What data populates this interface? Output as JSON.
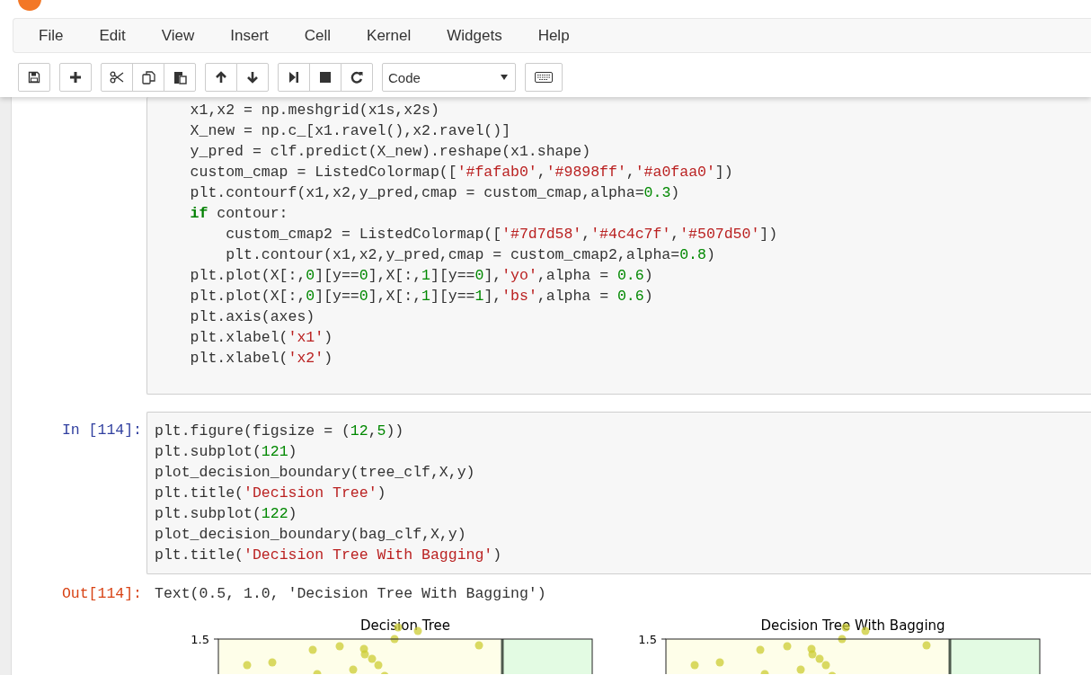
{
  "menu": [
    {
      "label": "File"
    },
    {
      "label": "Edit"
    },
    {
      "label": "View"
    },
    {
      "label": "Insert"
    },
    {
      "label": "Cell"
    },
    {
      "label": "Kernel"
    },
    {
      "label": "Widgets"
    },
    {
      "label": "Help"
    }
  ],
  "toolbar": {
    "groups": [
      [
        {
          "kind": "save"
        }
      ],
      [
        {
          "kind": "add"
        }
      ],
      [
        {
          "kind": "cut"
        },
        {
          "kind": "copy"
        },
        {
          "kind": "paste"
        }
      ],
      [
        {
          "kind": "up"
        },
        {
          "kind": "down"
        }
      ],
      [
        {
          "kind": "run"
        },
        {
          "kind": "stop"
        },
        {
          "kind": "restart"
        }
      ]
    ],
    "cell_type": "Code"
  },
  "cells": [
    {
      "lines": [
        {
          "tokens": [
            {
              "kind": "plain",
              "text": "x1,x2 = np.meshgrid(x1s,x2s)"
            }
          ]
        },
        {
          "tokens": [
            {
              "kind": "plain",
              "text": "X_new = np.c_[x1.ravel(),x2.ravel()]"
            }
          ]
        },
        {
          "tokens": [
            {
              "kind": "plain",
              "text": "y_pred = clf.predict(X_new).reshape(x1.shape)"
            }
          ]
        },
        {
          "tokens": [
            {
              "kind": "plain",
              "text": "custom_cmap = ListedColormap(["
            },
            {
              "kind": "str",
              "text": "'#fafab0'"
            },
            {
              "kind": "plain",
              "text": ","
            },
            {
              "kind": "str",
              "text": "'#9898ff'"
            },
            {
              "kind": "plain",
              "text": ","
            },
            {
              "kind": "str",
              "text": "'#a0faa0'"
            },
            {
              "kind": "plain",
              "text": "])"
            }
          ]
        },
        {
          "tokens": [
            {
              "kind": "plain",
              "text": "plt.contourf(x1,x2,y_pred,cmap = custom_cmap,alpha="
            },
            {
              "kind": "num",
              "text": "0.3"
            },
            {
              "kind": "plain",
              "text": ")"
            }
          ]
        },
        {
          "tokens": [
            {
              "kind": "kw",
              "text": "if"
            },
            {
              "kind": "plain",
              "text": " contour:"
            }
          ],
          "children": [
            {
              "tokens": [
                {
                  "kind": "plain",
                  "text": "custom_cmap2 = ListedColormap(["
                },
                {
                  "kind": "str",
                  "text": "'#7d7d58'"
                },
                {
                  "kind": "plain",
                  "text": ","
                },
                {
                  "kind": "str",
                  "text": "'#4c4c7f'"
                },
                {
                  "kind": "plain",
                  "text": ","
                },
                {
                  "kind": "str",
                  "text": "'#507d50'"
                },
                {
                  "kind": "plain",
                  "text": "])"
                }
              ]
            },
            {
              "tokens": [
                {
                  "kind": "plain",
                  "text": "plt.contour(x1,x2,y_pred,cmap = custom_cmap2,alpha="
                },
                {
                  "kind": "num",
                  "text": "0.8"
                },
                {
                  "kind": "plain",
                  "text": ")"
                }
              ]
            }
          ]
        },
        {
          "tokens": [
            {
              "kind": "plain",
              "text": "plt.plot(X[:,"
            },
            {
              "kind": "num",
              "text": "0"
            },
            {
              "kind": "plain",
              "text": "][y=="
            },
            {
              "kind": "num",
              "text": "0"
            },
            {
              "kind": "plain",
              "text": "],X[:,"
            },
            {
              "kind": "num",
              "text": "1"
            },
            {
              "kind": "plain",
              "text": "][y=="
            },
            {
              "kind": "num",
              "text": "0"
            },
            {
              "kind": "plain",
              "text": "],"
            },
            {
              "kind": "str",
              "text": "'yo'"
            },
            {
              "kind": "plain",
              "text": ",alpha = "
            },
            {
              "kind": "num",
              "text": "0.6"
            },
            {
              "kind": "plain",
              "text": ")"
            }
          ]
        },
        {
          "tokens": [
            {
              "kind": "plain",
              "text": "plt.plot(X[:,"
            },
            {
              "kind": "num",
              "text": "0"
            },
            {
              "kind": "plain",
              "text": "][y=="
            },
            {
              "kind": "num",
              "text": "0"
            },
            {
              "kind": "plain",
              "text": "],X[:,"
            },
            {
              "kind": "num",
              "text": "1"
            },
            {
              "kind": "plain",
              "text": "][y=="
            },
            {
              "kind": "num",
              "text": "1"
            },
            {
              "kind": "plain",
              "text": "],"
            },
            {
              "kind": "str",
              "text": "'bs'"
            },
            {
              "kind": "plain",
              "text": ",alpha = "
            },
            {
              "kind": "num",
              "text": "0.6"
            },
            {
              "kind": "plain",
              "text": ")"
            }
          ]
        },
        {
          "tokens": [
            {
              "kind": "plain",
              "text": "plt.axis(axes)"
            }
          ]
        },
        {
          "tokens": [
            {
              "kind": "plain",
              "text": "plt.xlabel("
            },
            {
              "kind": "str",
              "text": "'x1'"
            },
            {
              "kind": "plain",
              "text": ")"
            }
          ]
        },
        {
          "tokens": [
            {
              "kind": "plain",
              "text": "plt.xlabel("
            },
            {
              "kind": "str",
              "text": "'x2'"
            },
            {
              "kind": "plain",
              "text": ")"
            }
          ]
        }
      ]
    },
    {
      "prompt": "In [114]:",
      "lines": [
        {
          "tokens": [
            {
              "kind": "plain",
              "text": "plt.figure(figsize = ("
            },
            {
              "kind": "num",
              "text": "12"
            },
            {
              "kind": "plain",
              "text": ","
            },
            {
              "kind": "num",
              "text": "5"
            },
            {
              "kind": "plain",
              "text": "))"
            }
          ]
        },
        {
          "tokens": [
            {
              "kind": "plain",
              "text": "plt.subplot("
            },
            {
              "kind": "num",
              "text": "121"
            },
            {
              "kind": "plain",
              "text": ")"
            }
          ]
        },
        {
          "tokens": [
            {
              "kind": "plain",
              "text": "plot_decision_boundary(tree_clf,X,y)"
            }
          ]
        },
        {
          "tokens": [
            {
              "kind": "plain",
              "text": "plt.title("
            },
            {
              "kind": "str",
              "text": "'Decision Tree'"
            },
            {
              "kind": "plain",
              "text": ")"
            }
          ]
        },
        {
          "tokens": [
            {
              "kind": "plain",
              "text": "plt.subplot("
            },
            {
              "kind": "num",
              "text": "122"
            },
            {
              "kind": "plain",
              "text": ")"
            }
          ]
        },
        {
          "tokens": [
            {
              "kind": "plain",
              "text": "plot_decision_boundary(bag_clf,X,y)"
            }
          ]
        },
        {
          "tokens": [
            {
              "kind": "plain",
              "text": "plt.title("
            },
            {
              "kind": "str",
              "text": "'Decision Tree With Bagging'"
            },
            {
              "kind": "plain",
              "text": ")"
            }
          ]
        }
      ]
    }
  ],
  "output": {
    "prompt": "Out[114]:",
    "text": "Text(0.5, 1.0, 'Decision Tree With Bagging')"
  },
  "figure": {
    "plots": [
      {
        "title": "Decision Tree",
        "ytick": "1.5"
      },
      {
        "title": "Decision Tree With Bagging",
        "ytick": "1.5"
      }
    ]
  }
}
